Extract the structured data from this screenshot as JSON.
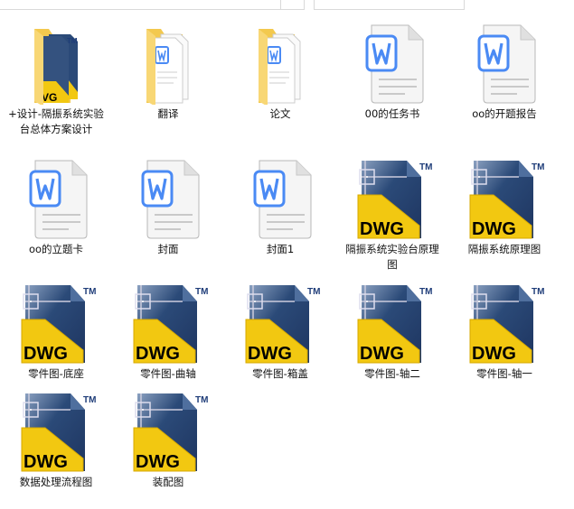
{
  "files": [
    {
      "name": "+设计-隔振系统实验台总体方案设计",
      "type": "folder-dwg"
    },
    {
      "name": "翻译",
      "type": "folder-word"
    },
    {
      "name": "论文",
      "type": "folder-word"
    },
    {
      "name": "00的任务书",
      "type": "word"
    },
    {
      "name": "oo的开题报告",
      "type": "word"
    },
    {
      "name": "oo的立题卡",
      "type": "word"
    },
    {
      "name": "封面",
      "type": "word"
    },
    {
      "name": "封面1",
      "type": "word"
    },
    {
      "name": "隔振系统实验台原理图",
      "type": "dwg"
    },
    {
      "name": "隔振系统原理图",
      "type": "dwg"
    },
    {
      "name": "零件图-底座",
      "type": "dwg"
    },
    {
      "name": "零件图-曲轴",
      "type": "dwg"
    },
    {
      "name": "零件图-箱盖",
      "type": "dwg"
    },
    {
      "name": "零件图-轴二",
      "type": "dwg"
    },
    {
      "name": "零件图-轴一",
      "type": "dwg"
    },
    {
      "name": "数据处理流程图",
      "type": "dwg"
    },
    {
      "name": "装配图",
      "type": "dwg"
    }
  ],
  "icon_text": {
    "dwg": "DWG",
    "tm": "TM",
    "word": "W"
  },
  "colors": {
    "word_blue": "#4a8af4",
    "dwg_yellow": "#f2c811",
    "dwg_navy": "#2b4a78",
    "folder": "#f8d775"
  }
}
